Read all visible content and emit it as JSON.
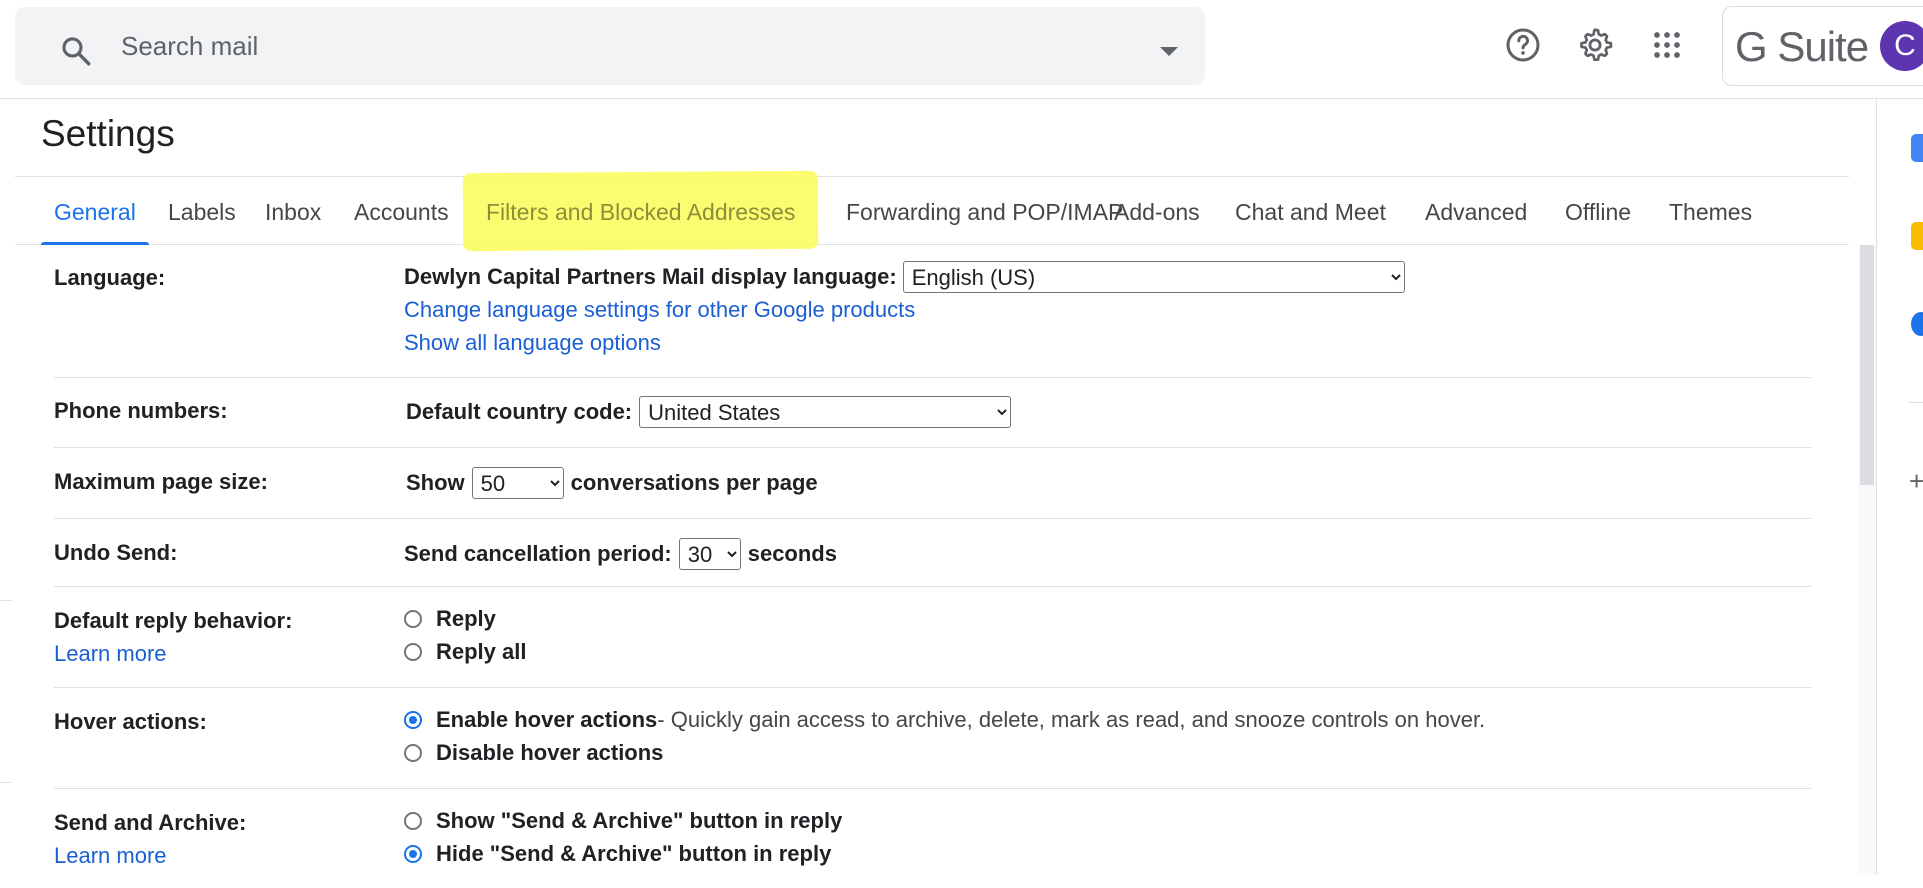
{
  "search": {
    "placeholder": "Search mail"
  },
  "header": {
    "brand": "G Suite",
    "avatar_letter": "C"
  },
  "page": {
    "title": "Settings"
  },
  "tabs": [
    {
      "label": "General",
      "active": true
    },
    {
      "label": "Labels"
    },
    {
      "label": "Inbox"
    },
    {
      "label": "Accounts"
    },
    {
      "label": "Filters and Blocked Addresses",
      "highlighted": true
    },
    {
      "label": "Forwarding and POP/IMAP"
    },
    {
      "label": "Add-ons"
    },
    {
      "label": "Chat and Meet"
    },
    {
      "label": "Advanced"
    },
    {
      "label": "Offline"
    },
    {
      "label": "Themes"
    }
  ],
  "settings": {
    "language": {
      "label": "Language:",
      "display_label": "Dewlyn Capital Partners Mail display language:",
      "selected": "English (US)",
      "link1": "Change language settings for other Google products",
      "link2": "Show all language options"
    },
    "phone": {
      "label": "Phone numbers:",
      "country_label": "Default country code:",
      "selected": "United States"
    },
    "page_size": {
      "label": "Maximum page size:",
      "prefix": "Show",
      "selected": "50",
      "suffix": "conversations per page"
    },
    "undo_send": {
      "label": "Undo Send:",
      "prefix": "Send cancellation period:",
      "selected": "30",
      "suffix": "seconds"
    },
    "reply": {
      "label": "Default reply behavior:",
      "learn_more": "Learn more",
      "option1": "Reply",
      "option2": "Reply all"
    },
    "hover": {
      "label": "Hover actions:",
      "option1": "Enable hover actions",
      "option1_desc": " - Quickly gain access to archive, delete, mark as read, and snooze controls on hover.",
      "option2": "Disable hover actions"
    },
    "send_archive": {
      "label": "Send and Archive:",
      "learn_more": "Learn more",
      "option1": "Show \"Send & Archive\" button in reply",
      "option2": "Hide \"Send & Archive\" button in reply"
    }
  },
  "icons": {
    "search": "search-icon",
    "help": "help-icon",
    "settings": "gear-icon",
    "apps": "apps-grid-icon"
  },
  "colors": {
    "accent": "#1a73e8",
    "highlight": "#fbfc60",
    "avatar": "#5e35b1"
  }
}
